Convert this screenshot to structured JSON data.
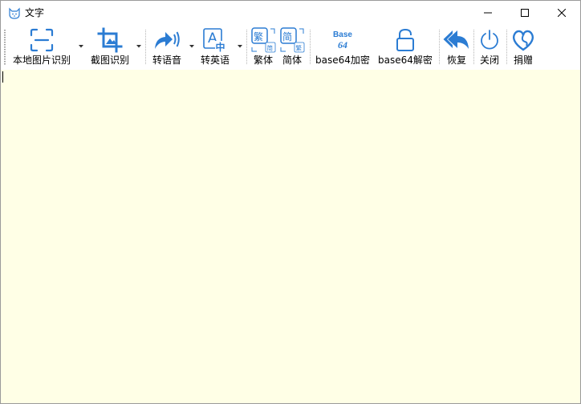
{
  "window": {
    "title": "文字"
  },
  "colors": {
    "icon_blue": "#2b7cd3",
    "editor_bg": "#ffffe6"
  },
  "toolbar": {
    "local_ocr": "本地图片识别",
    "screenshot_ocr": "截图识别",
    "to_speech": "转语音",
    "to_english": "转英语",
    "traditional": "繁体",
    "simplified": "简体",
    "base64_encode": "base64加密",
    "base64_decode": "base64解密",
    "restore": "恢复",
    "close": "关闭",
    "donate": "捐赠"
  },
  "icons": {
    "trad_main": "繁",
    "trad_sub": "简",
    "simp_main": "简",
    "simp_sub": "繁",
    "base64_line1": "Base",
    "base64_line2": "64",
    "translate_a": "A",
    "translate_zh": "中"
  },
  "editor": {
    "content": ""
  }
}
